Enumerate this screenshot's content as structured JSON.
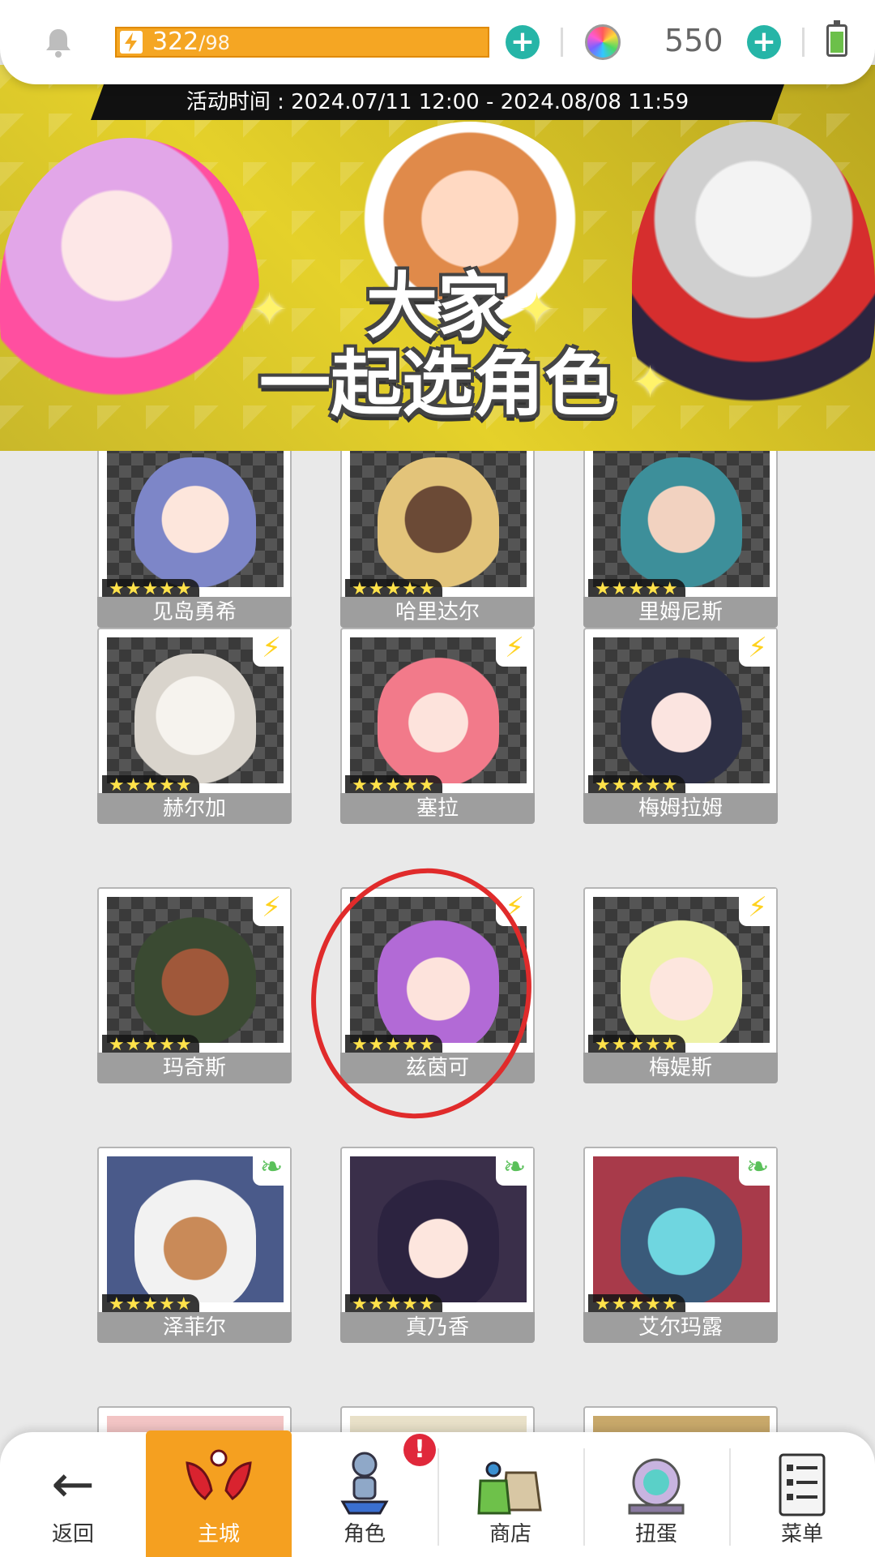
{
  "status": {
    "energy_current": "322",
    "energy_max": "/98",
    "gem_count": "550",
    "battery_level": 0.75,
    "icons": [
      "bell-icon",
      "lightning-icon",
      "plus-icon",
      "gem-icon",
      "battery-icon"
    ]
  },
  "banner": {
    "event_time": "活动时间 : 2024.07/11 12:00 - 2024.08/08 11:59",
    "title_line1": "大家",
    "title_line2": "一起选角色"
  },
  "characters": [
    {
      "name": "见岛勇希",
      "stars": "★★★★★",
      "element": ""
    },
    {
      "name": "哈里达尔",
      "stars": "★★★★★",
      "element": ""
    },
    {
      "name": "里姆尼斯",
      "stars": "★★★★★",
      "element": ""
    },
    {
      "name": "赫尔加",
      "stars": "★★★★★",
      "element": "lightning"
    },
    {
      "name": "塞拉",
      "stars": "★★★★★",
      "element": "lightning"
    },
    {
      "name": "梅姆拉姆",
      "stars": "★★★★★",
      "element": "lightning"
    },
    {
      "name": "玛奇斯",
      "stars": "★★★★★",
      "element": "lightning"
    },
    {
      "name": "兹茵可",
      "stars": "★★★★★",
      "element": "lightning"
    },
    {
      "name": "梅媞斯",
      "stars": "★★★★★",
      "element": "lightning"
    },
    {
      "name": "泽菲尔",
      "stars": "★★★★★",
      "element": "wind"
    },
    {
      "name": "真乃香",
      "stars": "★★★★★",
      "element": "wind"
    },
    {
      "name": "艾尔玛露",
      "stars": "★★★★★",
      "element": "wind"
    }
  ],
  "colors": {
    "accent": "#f5a020",
    "energy": "#f5a623",
    "plus": "#26b5a7",
    "highlight": "#e02b2b"
  },
  "nav": {
    "back": "返回",
    "city": "主城",
    "character": "角色",
    "shop": "商店",
    "gacha": "扭蛋",
    "menu": "菜单",
    "character_badge": "!"
  }
}
